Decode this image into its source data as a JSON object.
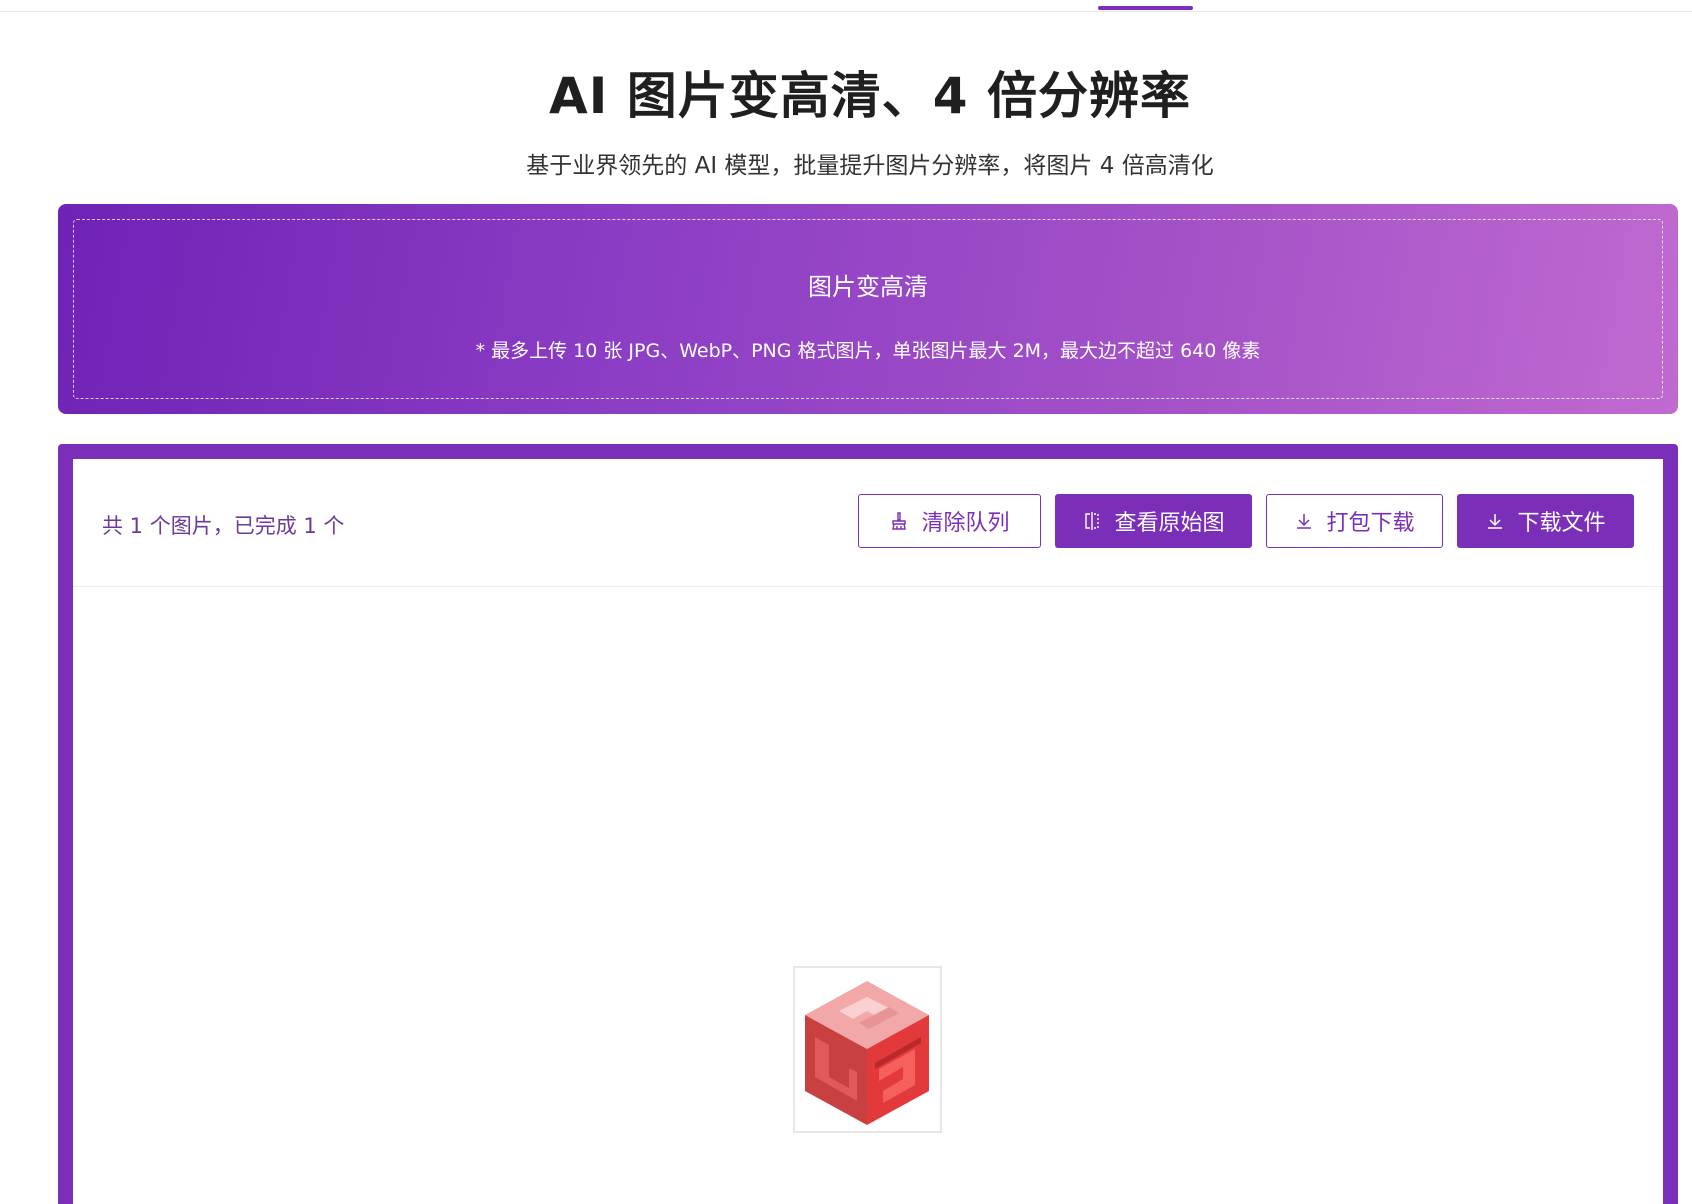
{
  "header": {
    "title": "AI 图片变高清、4 倍分辨率",
    "subtitle": "基于业界领先的 AI 模型，批量提升图片分辨率，将图片 4 倍高清化"
  },
  "upload": {
    "title": "图片变高清",
    "hint": "* 最多上传 10 张 JPG、WebP、PNG 格式图片，单张图片最大 2M，最大边不超过 640 像素"
  },
  "queue": {
    "status": "共 1 个图片，已完成 1 个",
    "buttons": {
      "clear": {
        "label": "清除队列",
        "icon": "broom-icon"
      },
      "view_original": {
        "label": "查看原始图",
        "icon": "compare-icon"
      },
      "zip_download": {
        "label": "打包下载",
        "icon": "download-icon"
      },
      "download_file": {
        "label": "下载文件",
        "icon": "download-icon"
      }
    }
  },
  "theme": {
    "accent": "#7b2fb8",
    "banner_start": "#6f22b5",
    "banner_end": "#c06ad0"
  }
}
